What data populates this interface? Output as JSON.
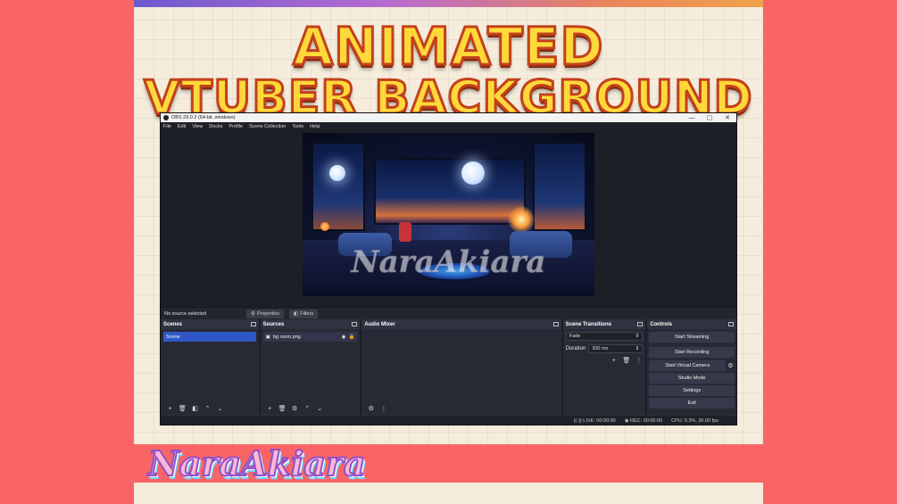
{
  "poster": {
    "title_line1": "ANIMATED",
    "title_line2": "VTUBER BACKGROUND",
    "watermark": "NaraAkiara",
    "brand_logo": "NaraAkiara"
  },
  "obs": {
    "window_title": "OBS 29.0.2 (64-bit, windows)",
    "window_buttons": {
      "minimize": "—",
      "maximize": "▢",
      "close": "✕"
    },
    "menu": [
      "File",
      "Edit",
      "View",
      "Docks",
      "Profile",
      "Scene Collection",
      "Tools",
      "Help"
    ],
    "source_bar": {
      "status": "No source selected",
      "properties_label": "Properties",
      "filters_label": "Filters"
    },
    "docks": {
      "scenes": {
        "title": "Scenes",
        "items": [
          "Scene"
        ]
      },
      "sources": {
        "title": "Sources",
        "items": [
          "bg room.png"
        ]
      },
      "audio_mixer": {
        "title": "Audio Mixer"
      },
      "scene_transitions": {
        "title": "Scene Transitions",
        "transition": "Fade",
        "duration_label": "Duration",
        "duration_value": "300 ms"
      },
      "controls": {
        "title": "Controls",
        "start_streaming": "Start Streaming",
        "start_recording": "Start Recording",
        "start_virtual_camera": "Start Virtual Camera",
        "studio_mode": "Studio Mode",
        "settings": "Settings",
        "exit": "Exit"
      }
    },
    "status": {
      "live": "LIVE: 00:00:00",
      "rec": "REC: 00:00:00",
      "cpu": "CPU: 0.3%, 30.00 fps"
    }
  },
  "colors": {
    "background": "#f96566",
    "poster_bg": "#f5ecdc",
    "title_fill": "#ffd93a",
    "title_stroke": "#c2411c",
    "selected_scene": "#2f57c6"
  }
}
